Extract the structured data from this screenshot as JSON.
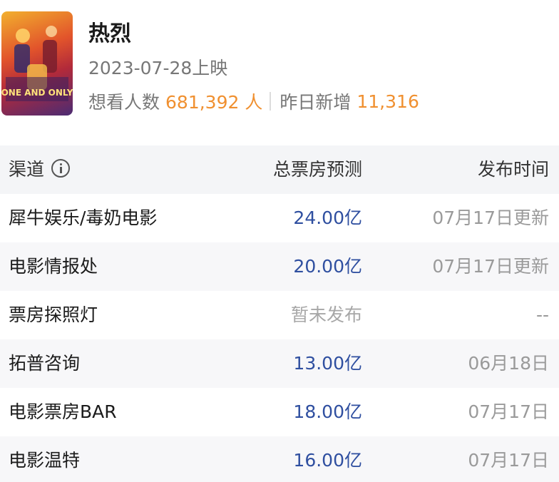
{
  "movie": {
    "title": "热烈",
    "poster_text": "ONE AND ONLY",
    "release": "2023-07-28上映",
    "want_label": "想看人数",
    "want_count": "681,392 人",
    "new_label": "昨日新增",
    "new_count": "11,316"
  },
  "colors": {
    "accent_orange": "#f09030",
    "forecast_blue": "#2f4fa0",
    "muted_gray": "#9a9a9a",
    "header_bg": "#f4f5f7"
  },
  "icons": {
    "info": "info-circle-icon"
  },
  "table": {
    "headers": {
      "channel": "渠道",
      "forecast": "总票房预测",
      "time": "发布时间"
    },
    "rows": [
      {
        "channel": "犀牛娱乐/毒奶电影",
        "forecast": "24.00亿",
        "time": "07月17日更新"
      },
      {
        "channel": "电影情报处",
        "forecast": "20.00亿",
        "time": "07月17日更新"
      },
      {
        "channel": "票房探照灯",
        "forecast": "暂未发布",
        "time": "--"
      },
      {
        "channel": "拓普咨询",
        "forecast": "13.00亿",
        "time": "06月18日"
      },
      {
        "channel": "电影票房BAR",
        "forecast": "18.00亿",
        "time": "07月17日"
      },
      {
        "channel": "电影温特",
        "forecast": "16.00亿",
        "time": "07月17日"
      }
    ]
  }
}
